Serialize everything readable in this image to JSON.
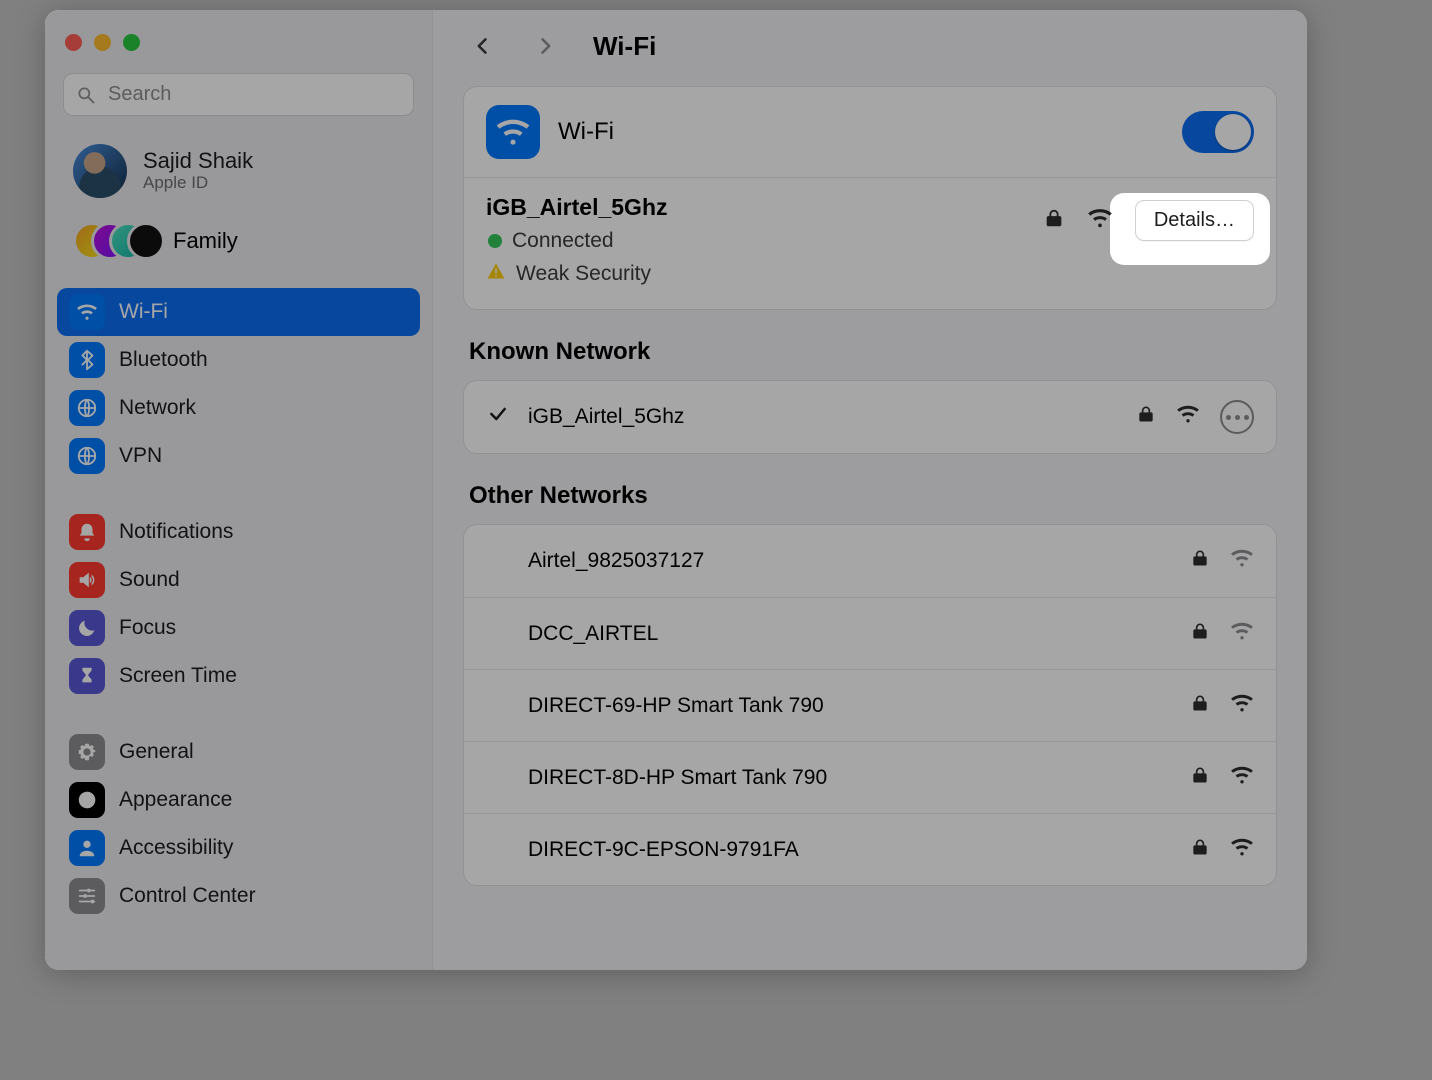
{
  "window": {
    "search_placeholder": "Search"
  },
  "sidebar": {
    "user": {
      "name": "Sajid Shaik",
      "sub": "Apple ID"
    },
    "family_label": "Family",
    "items": {
      "wifi": "Wi-Fi",
      "bluetooth": "Bluetooth",
      "network": "Network",
      "vpn": "VPN",
      "notifications": "Notifications",
      "sound": "Sound",
      "focus": "Focus",
      "screentime": "Screen Time",
      "general": "General",
      "appearance": "Appearance",
      "accessibility": "Accessibility",
      "controlcenter": "Control Center"
    }
  },
  "toolbar": {
    "title": "Wi-Fi"
  },
  "wifi": {
    "toggle_label": "Wi-Fi",
    "current": {
      "ssid": "iGB_Airtel_5Ghz",
      "status_connected": "Connected",
      "status_warning": "Weak Security",
      "details_label": "Details…"
    },
    "known_title": "Known Network",
    "known": [
      {
        "ssid": "iGB_Airtel_5Ghz",
        "connected": true,
        "secure": true,
        "strong": true
      }
    ],
    "other_title": "Other Networks",
    "other": [
      {
        "ssid": "Airtel_9825037127",
        "secure": true,
        "strong": false
      },
      {
        "ssid": "DCC_AIRTEL",
        "secure": true,
        "strong": false
      },
      {
        "ssid": "DIRECT-69-HP Smart Tank 790",
        "secure": true,
        "strong": true
      },
      {
        "ssid": "DIRECT-8D-HP Smart Tank 790",
        "secure": true,
        "strong": true
      },
      {
        "ssid": "DIRECT-9C-EPSON-9791FA",
        "secure": true,
        "strong": true
      }
    ]
  }
}
